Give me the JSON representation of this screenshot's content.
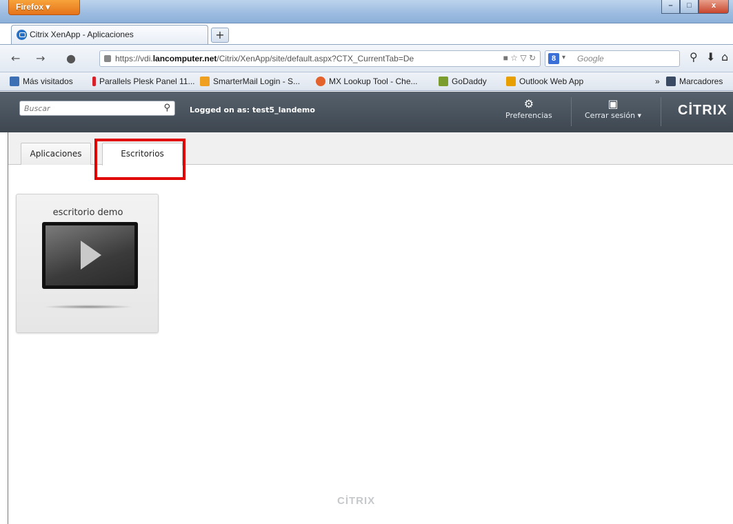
{
  "browser": {
    "menu_label": "Firefox ▾",
    "window_controls": {
      "minimize": "–",
      "maximize": "□",
      "close": "x"
    },
    "tab": {
      "title": "Citrix XenApp - Aplicaciones"
    },
    "new_tab_label": "+",
    "url": {
      "prefix": "https://vdi.",
      "domain": "lancomputer.net",
      "path": "/Citrix/XenApp/site/default.aspx?CTX_CurrentTab=De"
    },
    "search": {
      "engine_badge": "8",
      "placeholder": "Google"
    },
    "bookmarks": [
      {
        "label": "Más visitados",
        "icon": "most-visited-icon",
        "color": "#3d6fb5"
      },
      {
        "label": "Parallels Plesk Panel 11...",
        "icon": "plesk-icon",
        "color": "#d6212b"
      },
      {
        "label": "SmarterMail Login - S...",
        "icon": "mail-icon",
        "color": "#f0a020"
      },
      {
        "label": "MX Lookup Tool - Che...",
        "icon": "mx-icon",
        "color": "#e4622b"
      },
      {
        "label": "GoDaddy",
        "icon": "godaddy-icon",
        "color": "#7a9d2e"
      },
      {
        "label": "Outlook Web App",
        "icon": "outlook-icon",
        "color": "#e8a000"
      },
      {
        "label": "Marcadores",
        "icon": "bookmarks-star-icon",
        "color": "#3b4a63"
      }
    ],
    "bookmarks_overflow": "»"
  },
  "citrix": {
    "search_placeholder": "Buscar",
    "logged_on": "Logged on as: test5_landemo",
    "preferences_label": "Preferencias",
    "logout_label": "Cerrar sesión ▾",
    "logo": "CİTRIX",
    "tabs": [
      {
        "label": "Aplicaciones",
        "active": false
      },
      {
        "label": "Escritorios",
        "active": true
      }
    ],
    "desktops": [
      {
        "name": "escritorio demo"
      }
    ],
    "footer_logo": "CİTRIX",
    "highlight_color": "#e00000"
  }
}
